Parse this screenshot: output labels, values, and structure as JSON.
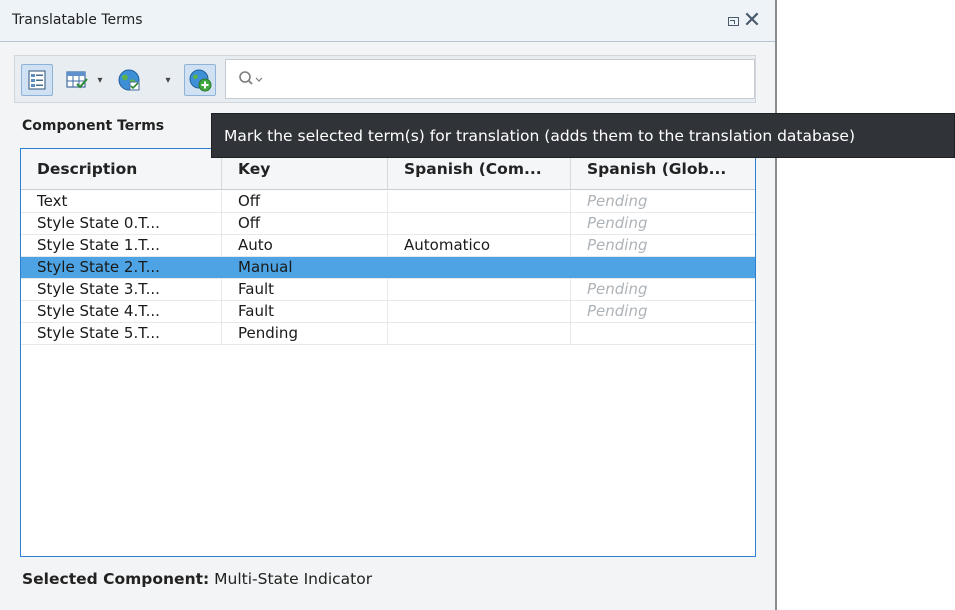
{
  "window": {
    "title": "Translatable Terms"
  },
  "toolbar": {
    "search_placeholder": ""
  },
  "section_label": "Component Terms",
  "tooltip": "Mark the selected term(s) for translation (adds them to the translation database)",
  "table": {
    "columns": [
      "Description",
      "Key",
      "Spanish (Com...",
      "Spanish (Glob..."
    ],
    "rows": [
      {
        "description": "Text",
        "key": "Off",
        "spanish_com": "",
        "spanish_glob": "Pending",
        "selected": false
      },
      {
        "description": "Style State 0.T...",
        "key": "Off",
        "spanish_com": "",
        "spanish_glob": "Pending",
        "selected": false
      },
      {
        "description": "Style State 1.T...",
        "key": "Auto",
        "spanish_com": "Automatico",
        "spanish_glob": "Pending",
        "selected": false
      },
      {
        "description": "Style State 2.T...",
        "key": "Manual",
        "spanish_com": "",
        "spanish_glob": "",
        "selected": true
      },
      {
        "description": "Style State 3.T...",
        "key": "Fault",
        "spanish_com": "",
        "spanish_glob": "Pending",
        "selected": false
      },
      {
        "description": "Style State 4.T...",
        "key": "Fault",
        "spanish_com": "",
        "spanish_glob": "Pending",
        "selected": false
      },
      {
        "description": "Style State 5.T...",
        "key": "Pending",
        "spanish_com": "",
        "spanish_glob": "",
        "selected": false
      }
    ]
  },
  "footer": {
    "label": "Selected Component",
    "separator": ":",
    "value": " Multi-State Indicator"
  },
  "colors": {
    "selection": "#4da3e3",
    "table_border": "#2f7fd1",
    "tooltip_bg": "#303438"
  },
  "icons": [
    "list-view-icon",
    "grid-check-icon",
    "globe-icon",
    "globe-add-icon",
    "search-icon",
    "restore-icon",
    "close-icon"
  ]
}
